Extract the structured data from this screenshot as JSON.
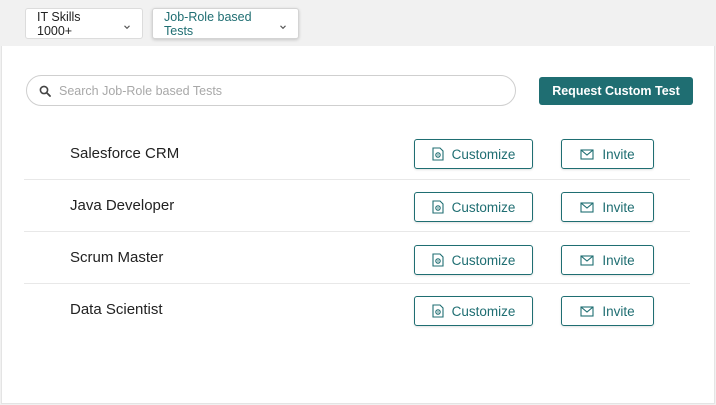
{
  "filters": {
    "skills_label": "IT Skills 1000+",
    "jobrole_label": "Job-Role based Tests"
  },
  "search": {
    "placeholder": "Search Job-Role based Tests",
    "value": ""
  },
  "request_button_label": "Request Custom Test",
  "rows": [
    {
      "name": "Salesforce CRM",
      "customize_label": "Customize",
      "invite_label": "Invite"
    },
    {
      "name": "Java Developer",
      "customize_label": "Customize",
      "invite_label": "Invite"
    },
    {
      "name": "Scrum Master",
      "customize_label": "Customize",
      "invite_label": "Invite"
    },
    {
      "name": "Data Scientist",
      "customize_label": "Customize",
      "invite_label": "Invite"
    }
  ],
  "colors": {
    "accent": "#1f6e72",
    "page_background": "#f1f1f1",
    "panel_background": "#ffffff"
  },
  "icons": {
    "dropdown": "chevron-down-icon",
    "search": "search-icon",
    "customize": "gear-document-icon",
    "invite": "envelope-icon"
  }
}
